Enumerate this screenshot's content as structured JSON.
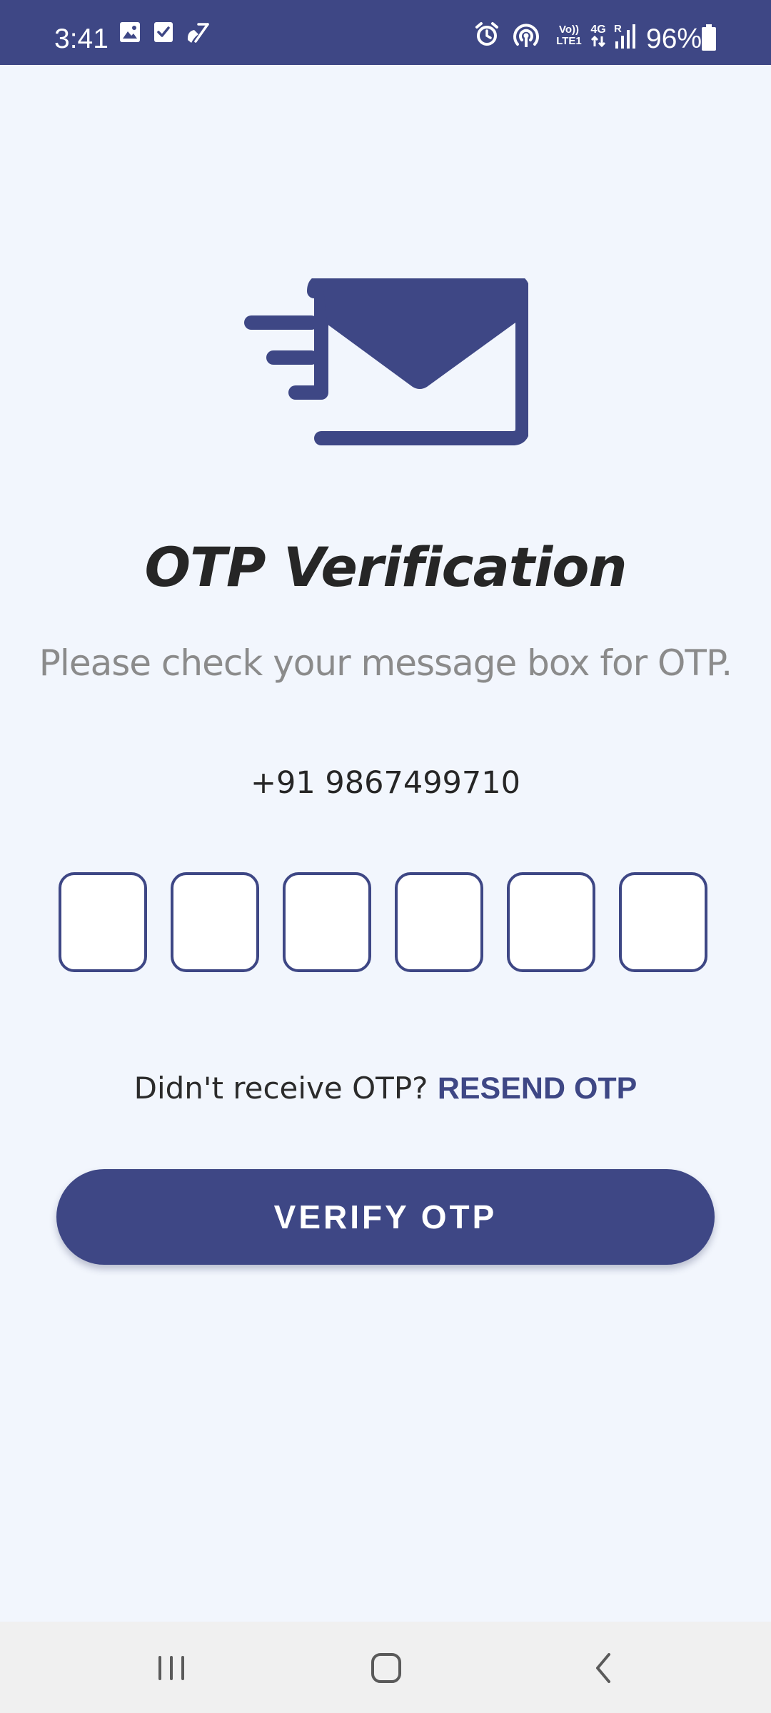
{
  "status_bar": {
    "time": "3:41",
    "battery_percent": "96%",
    "left_icons": [
      "gallery-icon",
      "checkbox-icon",
      "missed-call-icon"
    ],
    "right_icons": [
      "alarm-icon",
      "hotspot-icon",
      "volte-icon",
      "4g-data-icon",
      "signal-icon",
      "battery-icon"
    ],
    "volte_label_top": "Vo))",
    "volte_label_bottom": "LTE1",
    "network_label": "4G",
    "roaming_label": "R"
  },
  "hero": {
    "icon": "fast-mail-icon"
  },
  "page": {
    "title": "OTP Verification",
    "subtitle": "Please check your message box for OTP.",
    "phone_number": "+91 9867499710"
  },
  "otp": {
    "digits": [
      "",
      "",
      "",
      "",
      "",
      ""
    ]
  },
  "resend": {
    "prompt": "Didn't receive OTP?",
    "link_label": "RESEND OTP"
  },
  "actions": {
    "verify_label": "VERIFY OTP"
  },
  "colors": {
    "primary": "#3e4785",
    "background": "#f2f6fd",
    "title_text": "#262626",
    "subtitle_text": "#8b8b8b",
    "nav_bar": "#f0f0f0"
  },
  "nav_bar": {
    "buttons": [
      "recent-apps-icon",
      "home-icon",
      "back-icon"
    ]
  }
}
